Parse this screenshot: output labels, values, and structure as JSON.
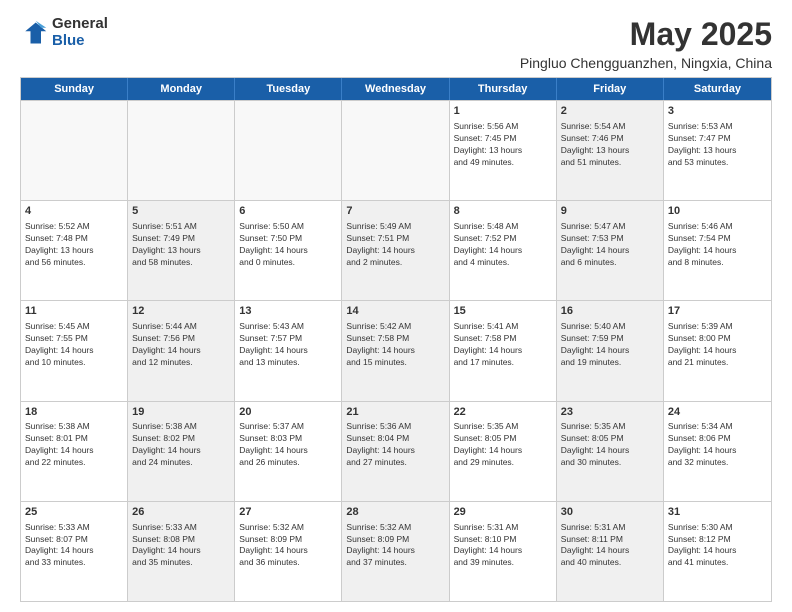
{
  "logo": {
    "general": "General",
    "blue": "Blue"
  },
  "title": "May 2025",
  "subtitle": "Pingluo Chengguanzhen, Ningxia, China",
  "weekdays": [
    "Sunday",
    "Monday",
    "Tuesday",
    "Wednesday",
    "Thursday",
    "Friday",
    "Saturday"
  ],
  "rows": [
    [
      {
        "day": "",
        "info": "",
        "empty": true
      },
      {
        "day": "",
        "info": "",
        "empty": true
      },
      {
        "day": "",
        "info": "",
        "empty": true
      },
      {
        "day": "",
        "info": "",
        "empty": true
      },
      {
        "day": "1",
        "info": "Sunrise: 5:56 AM\nSunset: 7:45 PM\nDaylight: 13 hours\nand 49 minutes."
      },
      {
        "day": "2",
        "info": "Sunrise: 5:54 AM\nSunset: 7:46 PM\nDaylight: 13 hours\nand 51 minutes.",
        "shaded": true
      },
      {
        "day": "3",
        "info": "Sunrise: 5:53 AM\nSunset: 7:47 PM\nDaylight: 13 hours\nand 53 minutes."
      }
    ],
    [
      {
        "day": "4",
        "info": "Sunrise: 5:52 AM\nSunset: 7:48 PM\nDaylight: 13 hours\nand 56 minutes."
      },
      {
        "day": "5",
        "info": "Sunrise: 5:51 AM\nSunset: 7:49 PM\nDaylight: 13 hours\nand 58 minutes.",
        "shaded": true
      },
      {
        "day": "6",
        "info": "Sunrise: 5:50 AM\nSunset: 7:50 PM\nDaylight: 14 hours\nand 0 minutes."
      },
      {
        "day": "7",
        "info": "Sunrise: 5:49 AM\nSunset: 7:51 PM\nDaylight: 14 hours\nand 2 minutes.",
        "shaded": true
      },
      {
        "day": "8",
        "info": "Sunrise: 5:48 AM\nSunset: 7:52 PM\nDaylight: 14 hours\nand 4 minutes."
      },
      {
        "day": "9",
        "info": "Sunrise: 5:47 AM\nSunset: 7:53 PM\nDaylight: 14 hours\nand 6 minutes.",
        "shaded": true
      },
      {
        "day": "10",
        "info": "Sunrise: 5:46 AM\nSunset: 7:54 PM\nDaylight: 14 hours\nand 8 minutes."
      }
    ],
    [
      {
        "day": "11",
        "info": "Sunrise: 5:45 AM\nSunset: 7:55 PM\nDaylight: 14 hours\nand 10 minutes."
      },
      {
        "day": "12",
        "info": "Sunrise: 5:44 AM\nSunset: 7:56 PM\nDaylight: 14 hours\nand 12 minutes.",
        "shaded": true
      },
      {
        "day": "13",
        "info": "Sunrise: 5:43 AM\nSunset: 7:57 PM\nDaylight: 14 hours\nand 13 minutes."
      },
      {
        "day": "14",
        "info": "Sunrise: 5:42 AM\nSunset: 7:58 PM\nDaylight: 14 hours\nand 15 minutes.",
        "shaded": true
      },
      {
        "day": "15",
        "info": "Sunrise: 5:41 AM\nSunset: 7:58 PM\nDaylight: 14 hours\nand 17 minutes."
      },
      {
        "day": "16",
        "info": "Sunrise: 5:40 AM\nSunset: 7:59 PM\nDaylight: 14 hours\nand 19 minutes.",
        "shaded": true
      },
      {
        "day": "17",
        "info": "Sunrise: 5:39 AM\nSunset: 8:00 PM\nDaylight: 14 hours\nand 21 minutes."
      }
    ],
    [
      {
        "day": "18",
        "info": "Sunrise: 5:38 AM\nSunset: 8:01 PM\nDaylight: 14 hours\nand 22 minutes."
      },
      {
        "day": "19",
        "info": "Sunrise: 5:38 AM\nSunset: 8:02 PM\nDaylight: 14 hours\nand 24 minutes.",
        "shaded": true
      },
      {
        "day": "20",
        "info": "Sunrise: 5:37 AM\nSunset: 8:03 PM\nDaylight: 14 hours\nand 26 minutes."
      },
      {
        "day": "21",
        "info": "Sunrise: 5:36 AM\nSunset: 8:04 PM\nDaylight: 14 hours\nand 27 minutes.",
        "shaded": true
      },
      {
        "day": "22",
        "info": "Sunrise: 5:35 AM\nSunset: 8:05 PM\nDaylight: 14 hours\nand 29 minutes."
      },
      {
        "day": "23",
        "info": "Sunrise: 5:35 AM\nSunset: 8:05 PM\nDaylight: 14 hours\nand 30 minutes.",
        "shaded": true
      },
      {
        "day": "24",
        "info": "Sunrise: 5:34 AM\nSunset: 8:06 PM\nDaylight: 14 hours\nand 32 minutes."
      }
    ],
    [
      {
        "day": "25",
        "info": "Sunrise: 5:33 AM\nSunset: 8:07 PM\nDaylight: 14 hours\nand 33 minutes."
      },
      {
        "day": "26",
        "info": "Sunrise: 5:33 AM\nSunset: 8:08 PM\nDaylight: 14 hours\nand 35 minutes.",
        "shaded": true
      },
      {
        "day": "27",
        "info": "Sunrise: 5:32 AM\nSunset: 8:09 PM\nDaylight: 14 hours\nand 36 minutes."
      },
      {
        "day": "28",
        "info": "Sunrise: 5:32 AM\nSunset: 8:09 PM\nDaylight: 14 hours\nand 37 minutes.",
        "shaded": true
      },
      {
        "day": "29",
        "info": "Sunrise: 5:31 AM\nSunset: 8:10 PM\nDaylight: 14 hours\nand 39 minutes."
      },
      {
        "day": "30",
        "info": "Sunrise: 5:31 AM\nSunset: 8:11 PM\nDaylight: 14 hours\nand 40 minutes.",
        "shaded": true
      },
      {
        "day": "31",
        "info": "Sunrise: 5:30 AM\nSunset: 8:12 PM\nDaylight: 14 hours\nand 41 minutes."
      }
    ]
  ]
}
